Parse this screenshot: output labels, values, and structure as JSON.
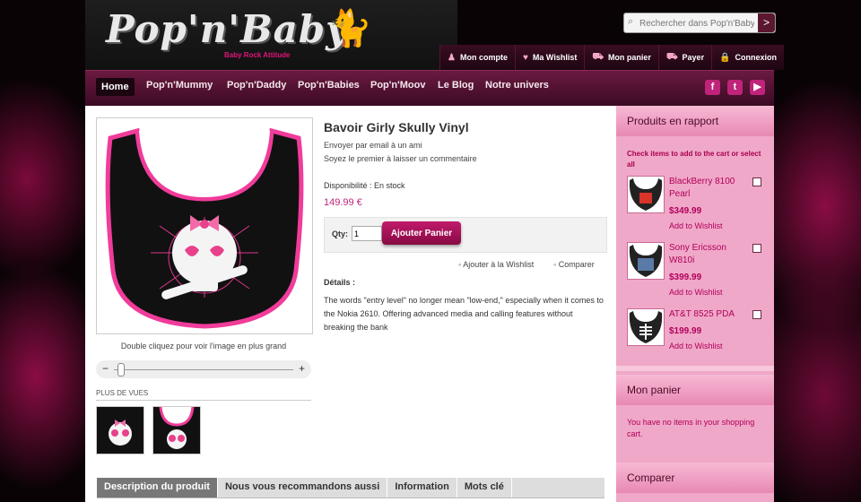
{
  "header": {
    "logo": "Pop'n'Baby",
    "tagline": "Baby Rock Attitude",
    "search_placeholder": "Rechercher dans Pop'n'Baby",
    "search_go": ">",
    "top_links": [
      {
        "label": "Mon compte",
        "icon": "user-icon"
      },
      {
        "label": "Ma Wishlist",
        "icon": "heart-icon"
      },
      {
        "label": "Mon panier",
        "icon": "cart-icon"
      },
      {
        "label": "Payer",
        "icon": "pay-icon"
      },
      {
        "label": "Connexion",
        "icon": "lock-icon"
      }
    ]
  },
  "nav": {
    "items": [
      "Home",
      "Pop'n'Mummy",
      "Pop'n'Daddy",
      "Pop'n'Babies",
      "Pop'n'Moov",
      "Le Blog",
      "Notre univers"
    ],
    "social": [
      {
        "label": "f",
        "icon": "facebook-icon"
      },
      {
        "label": "t",
        "icon": "twitter-icon"
      },
      {
        "label": "▶",
        "icon": "youtube-icon"
      }
    ]
  },
  "product": {
    "title": "Bavoir Girly Skully Vinyl",
    "email_friend": "Envoyer par email à un ami",
    "review": "Soyez le premier à laisser un commentaire",
    "availability": "Disponibilité : En stock",
    "price": "149.99 €",
    "qty_label": "Qty:",
    "qty_value": "1",
    "add_to_cart": "Ajouter Panier",
    "add_wishlist": "Ajouter à la Wishlist",
    "compare": "Comparer",
    "details_label": "Détails :",
    "description": "The words \"entry level\" no longer mean \"low-end,\" especially when it comes to the Nokia 2610. Offering advanced media and calling features without breaking the bank",
    "image_caption": "Double cliquez pour voir l'image en plus grand",
    "more_views": "PLUS DE VUES",
    "zoom_minus": "−",
    "zoom_plus": "+"
  },
  "tabs": [
    "Description du produit",
    "Nous vous recommandons aussi",
    "Information",
    "Mots clé"
  ],
  "sidebar": {
    "related_title": "Produits en rapport",
    "check_text": "Check items to add to the cart or select all",
    "related": [
      {
        "name": "BlackBerry 8100 Pearl",
        "price": "$349.99",
        "wishlist": "Add to Wishlist"
      },
      {
        "name": "Sony Ericsson W810i",
        "price": "$399.99",
        "wishlist": "Add to Wishlist"
      },
      {
        "name": "AT&T 8525 PDA",
        "price": "$199.99",
        "wishlist": "Add to Wishlist"
      }
    ],
    "cart_title": "Mon panier",
    "cart_text": "You have no items in your shopping cart.",
    "compare_title": "Comparer"
  },
  "colors": {
    "accent": "#c0237a",
    "nav": "#5a1535",
    "sidebar": "#f0a8c8"
  }
}
